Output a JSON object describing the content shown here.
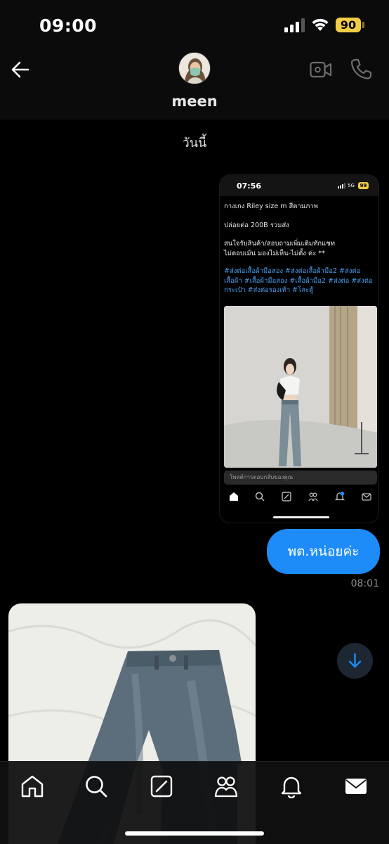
{
  "status_bar": {
    "time": "09:00",
    "battery": "90"
  },
  "header": {
    "contact_name": "meen"
  },
  "date_separator": "วันนี้",
  "shared_post": {
    "status_time": "07:56",
    "network": "5G",
    "battery": "99",
    "line1": "กางเกง Riley size m สีตามภาพ",
    "line2": "ปล่อยต่อ 200B รวมส่ง",
    "line3": "สนใจรับสินค้า/สอบถามเพิ่มเติมทักแชท",
    "line4": "ไม่ตอบเม้น มองไม่เห็น-ไม่ตั้ง ค่ะ **",
    "hashtags": "#ส่งต่อเสื้อผ้ามือสอง #ส่งต่อเสื้อผ้ามือ2 #ส่งต่อเสื้อผ้า #เสื้อผ้ามือสอง #เสื้อผ้ามือ2 #ส่งต่อ #ส่งต่อกระเป๋า #ส่งต่อรองเท้า #โละตู้",
    "reply_placeholder": "โพสต์การตอบกลับของคุณ"
  },
  "sent_message": {
    "text": "พต.หน่อยค่ะ",
    "time": "08:01"
  },
  "colors": {
    "bubble": "#1d8cf8",
    "link": "#4a9ff0",
    "battery": "#f2cd46"
  },
  "icons": {
    "nav": [
      "home-icon",
      "search-icon",
      "compose-icon",
      "communities-icon",
      "bell-icon",
      "mail-icon"
    ]
  }
}
